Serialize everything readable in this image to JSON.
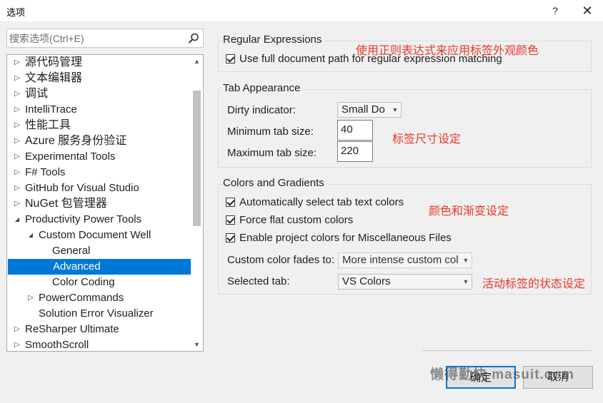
{
  "window": {
    "title": "选项",
    "help_label": "?",
    "close_label": "✕"
  },
  "search": {
    "placeholder": "搜索选项(Ctrl+E)",
    "icon": "search-icon"
  },
  "tree": {
    "items": [
      {
        "label": "源代码管理",
        "depth": 0,
        "toggle": "collapsed",
        "cjk": true
      },
      {
        "label": "文本编辑器",
        "depth": 0,
        "toggle": "collapsed",
        "cjk": true
      },
      {
        "label": "调试",
        "depth": 0,
        "toggle": "collapsed",
        "cjk": true
      },
      {
        "label": "IntelliTrace",
        "depth": 0,
        "toggle": "collapsed"
      },
      {
        "label": "性能工具",
        "depth": 0,
        "toggle": "collapsed",
        "cjk": true
      },
      {
        "label": "Azure 服务身份验证",
        "depth": 0,
        "toggle": "collapsed",
        "cjk": true
      },
      {
        "label": "Experimental Tools",
        "depth": 0,
        "toggle": "collapsed"
      },
      {
        "label": "F# Tools",
        "depth": 0,
        "toggle": "collapsed"
      },
      {
        "label": "GitHub for Visual Studio",
        "depth": 0,
        "toggle": "collapsed"
      },
      {
        "label": "NuGet 包管理器",
        "depth": 0,
        "toggle": "collapsed",
        "cjk": true
      },
      {
        "label": "Productivity Power Tools",
        "depth": 0,
        "toggle": "expanded"
      },
      {
        "label": "Custom Document Well",
        "depth": 1,
        "toggle": "expanded"
      },
      {
        "label": "General",
        "depth": 2,
        "toggle": "none"
      },
      {
        "label": "Advanced",
        "depth": 2,
        "toggle": "none",
        "selected": true
      },
      {
        "label": "Color Coding",
        "depth": 2,
        "toggle": "none"
      },
      {
        "label": "PowerCommands",
        "depth": 1,
        "toggle": "collapsed"
      },
      {
        "label": "Solution Error Visualizer",
        "depth": 1,
        "toggle": "none"
      },
      {
        "label": "ReSharper Ultimate",
        "depth": 0,
        "toggle": "collapsed"
      },
      {
        "label": "SmoothScroll",
        "depth": 0,
        "toggle": "collapsed"
      }
    ],
    "scroll_up": "▲",
    "scroll_down": "▼"
  },
  "regex": {
    "title": "Regular Expressions",
    "use_full_path": {
      "label": "Use full document path for regular expression matching",
      "checked": true
    }
  },
  "tab_appearance": {
    "title": "Tab Appearance",
    "dirty_indicator": {
      "label": "Dirty indicator:",
      "value": "Small Do"
    },
    "min_tab_size": {
      "label": "Minimum tab size:",
      "value": "40"
    },
    "max_tab_size": {
      "label": "Maximum tab size:",
      "value": "220"
    }
  },
  "colors": {
    "title": "Colors and Gradients",
    "auto_select": {
      "label": "Automatically select tab text colors",
      "checked": true
    },
    "force_flat": {
      "label": "Force flat custom colors",
      "checked": true
    },
    "project_colors": {
      "label": "Enable project colors for Miscellaneous Files",
      "checked": true
    },
    "fades_to": {
      "label": "Custom color fades to:",
      "value": "More intense custom col"
    },
    "selected_tab": {
      "label": "Selected tab:",
      "value": "VS Colors"
    }
  },
  "annotations": {
    "regex_note": "使用正则表达式来应用标签外观颜色",
    "size_note": "标签尺寸设定",
    "color_note": "颜色和渐变设定",
    "active_note": "活动标签的状态设定"
  },
  "buttons": {
    "ok": "确定",
    "cancel": "取消"
  },
  "watermark": "懒得勤快 masuit.com",
  "colors_theme": {
    "selection": "#0078d7",
    "annotation": "#e8372a"
  }
}
